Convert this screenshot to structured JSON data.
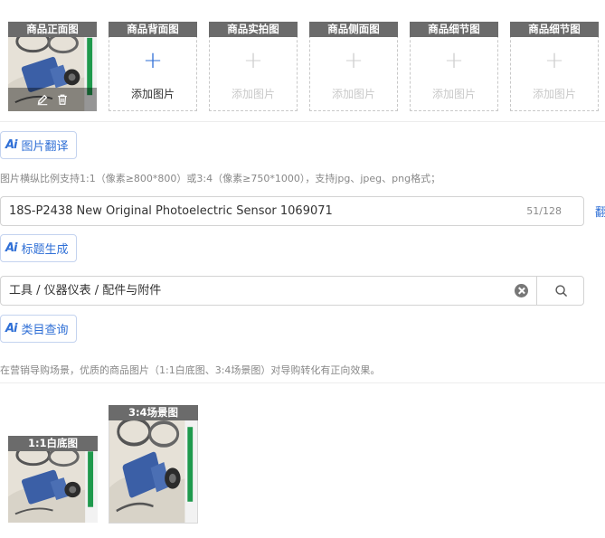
{
  "slots": [
    {
      "header": "商品正面图",
      "filled": true
    },
    {
      "header": "商品背面图",
      "label": "添加图片",
      "state": "active"
    },
    {
      "header": "商品实拍图",
      "label": "添加图片",
      "state": "disabled"
    },
    {
      "header": "商品侧面图",
      "label": "添加图片",
      "state": "disabled"
    },
    {
      "header": "商品细节图",
      "label": "添加图片",
      "state": "disabled"
    },
    {
      "header": "商品细节图",
      "label": "添加图片",
      "state": "disabled"
    }
  ],
  "image_translate": {
    "badge": "Ai",
    "label": "图片翻译"
  },
  "image_hint": "图片横纵比例支持1:1（像素≥800*800）或3:4（像素≥750*1000），支持jpg、jpeg、png格式；",
  "title_field": {
    "value": "18S-P2438 New Original Photoelectric Sensor 1069071",
    "counter": "51/128",
    "side_link": "翻"
  },
  "title_generate": {
    "badge": "Ai",
    "label": "标题生成"
  },
  "category_field": {
    "value": "工具 / 仪器仪表 / 配件与附件"
  },
  "category_query": {
    "badge": "Ai",
    "label": "类目查询"
  },
  "marketing_hint": "在营销导购场景，优质的商品图片（1:1白底图、3:4场景图）对导购转化有正向效果。",
  "marketing_images": [
    {
      "tag": "1:1白底图"
    },
    {
      "tag": "3:4场景图"
    }
  ],
  "colors": {
    "accent": "#2f6fd6",
    "header_bg": "#6b6b6b"
  }
}
